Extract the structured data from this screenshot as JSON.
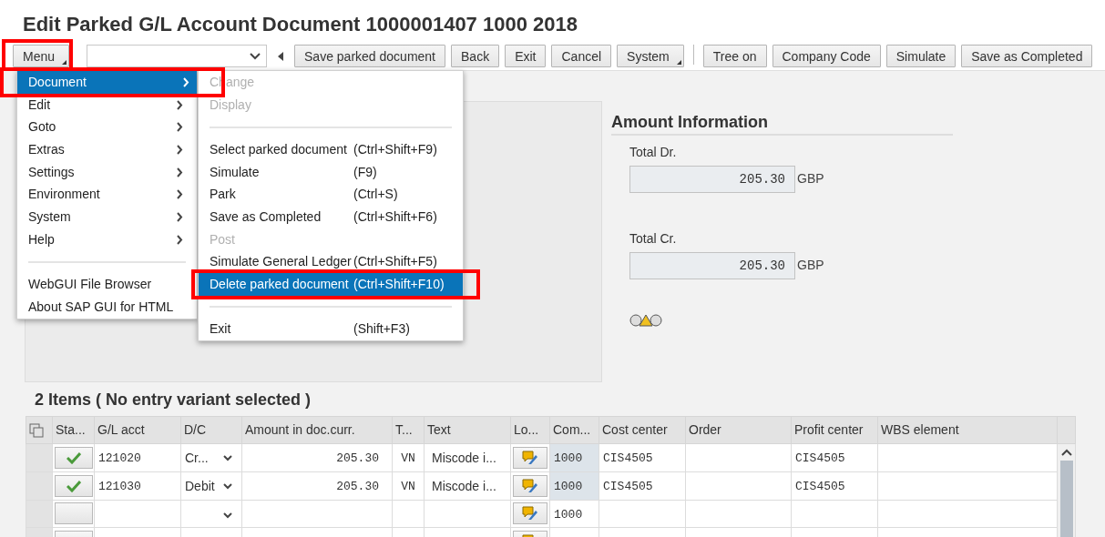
{
  "window": {
    "title": "Edit Parked G/L Account Document 1000001407 1000 2018"
  },
  "toolbar": {
    "menu_button": {
      "label": "Menu",
      "highlighted": true
    },
    "command_field": {
      "kind": "dropdown"
    },
    "buttons": [
      {
        "kind": "nav-back"
      },
      {
        "kind": "button",
        "label": "Save parked document",
        "dropdown": false
      },
      {
        "kind": "button",
        "label": "Back",
        "dropdown": false
      },
      {
        "kind": "button",
        "label": "Exit",
        "dropdown": false
      },
      {
        "kind": "button",
        "label": "Cancel",
        "dropdown": false
      },
      {
        "kind": "button",
        "label": "System",
        "dropdown": true
      },
      {
        "kind": "separator"
      },
      {
        "kind": "button",
        "label": "Tree on",
        "dropdown": false
      },
      {
        "kind": "button",
        "label": "Company Code",
        "dropdown": false
      },
      {
        "kind": "button",
        "label": "Simulate",
        "dropdown": false
      },
      {
        "kind": "button",
        "label": "Save as Completed",
        "dropdown": false
      }
    ]
  },
  "menu": {
    "items": [
      {
        "kind": "item",
        "label": "Document",
        "selected": true,
        "submenu": true,
        "highlighted": true
      },
      {
        "kind": "item",
        "label": "Edit",
        "selected": false,
        "submenu": true
      },
      {
        "kind": "item",
        "label": "Goto",
        "selected": false,
        "submenu": true
      },
      {
        "kind": "item",
        "label": "Extras",
        "selected": false,
        "submenu": true
      },
      {
        "kind": "item",
        "label": "Settings",
        "selected": false,
        "submenu": true
      },
      {
        "kind": "item",
        "label": "Environment",
        "selected": false,
        "submenu": true
      },
      {
        "kind": "item",
        "label": "System",
        "selected": false,
        "submenu": true
      },
      {
        "kind": "item",
        "label": "Help",
        "selected": false,
        "submenu": true
      },
      {
        "kind": "separator"
      },
      {
        "kind": "item",
        "label": "WebGUI File Browser",
        "selected": false,
        "submenu": false
      },
      {
        "kind": "item",
        "label": "About SAP GUI for HTML",
        "selected": false,
        "submenu": false
      }
    ]
  },
  "submenu": {
    "items": [
      {
        "kind": "item",
        "label": "Change",
        "disabled": true,
        "selected": false
      },
      {
        "kind": "item",
        "label": "Display",
        "disabled": true,
        "selected": false
      },
      {
        "kind": "separator"
      },
      {
        "kind": "item",
        "label": "Select parked document",
        "shortcut": "(Ctrl+Shift+F9)",
        "disabled": false,
        "selected": false
      },
      {
        "kind": "item",
        "label": "Simulate",
        "shortcut": "(F9)",
        "disabled": false,
        "selected": false
      },
      {
        "kind": "item",
        "label": "Park",
        "shortcut": "(Ctrl+S)",
        "disabled": false,
        "selected": false
      },
      {
        "kind": "item",
        "label": "Save as Completed",
        "shortcut": "(Ctrl+Shift+F6)",
        "disabled": false,
        "selected": false
      },
      {
        "kind": "item",
        "label": "Post",
        "disabled": true,
        "selected": false
      },
      {
        "kind": "item",
        "label": "Simulate General Ledger",
        "shortcut": "(Ctrl+Shift+F5)",
        "disabled": false,
        "selected": false
      },
      {
        "kind": "item",
        "label": "Delete parked document",
        "shortcut": "(Ctrl+Shift+F10)",
        "disabled": false,
        "selected": true,
        "highlighted": true
      },
      {
        "kind": "separator"
      },
      {
        "kind": "item",
        "label": "Exit",
        "shortcut": "(Shift+F3)",
        "disabled": false,
        "selected": false
      }
    ]
  },
  "amount_info": {
    "title": "Amount Information",
    "warning": true,
    "fields": [
      {
        "label": "Total Dr.",
        "value": "205.30",
        "unit": "GBP"
      },
      {
        "label": "Total Cr.",
        "value": "205.30",
        "unit": "GBP"
      }
    ]
  },
  "items_table": {
    "title": "2 Items ( No entry variant selected )",
    "columns": [
      "Sta...",
      "G/L acct",
      "D/C",
      "Amount in doc.curr.",
      "T...",
      "Text",
      "Lo...",
      "Com...",
      "Cost center",
      "Order",
      "Profit center",
      "WBS element"
    ],
    "rows": [
      {
        "checked": true,
        "gl_acct": "121020",
        "dc": "Cr...",
        "amount": "205.30",
        "tax": "VN",
        "text": "Miscode i...",
        "company": "1000",
        "company_readonly": true,
        "cost_center": "CIS4505",
        "profit_center": "CIS4505"
      },
      {
        "checked": true,
        "gl_acct": "121030",
        "dc": "Debit",
        "amount": "205.30",
        "tax": "VN",
        "text": "Miscode i...",
        "company": "1000",
        "company_readonly": true,
        "cost_center": "CIS4505",
        "profit_center": "CIS4505"
      },
      {
        "checked": false,
        "company": "1000",
        "company_readonly": false
      },
      {
        "company_readonly": false
      }
    ]
  }
}
